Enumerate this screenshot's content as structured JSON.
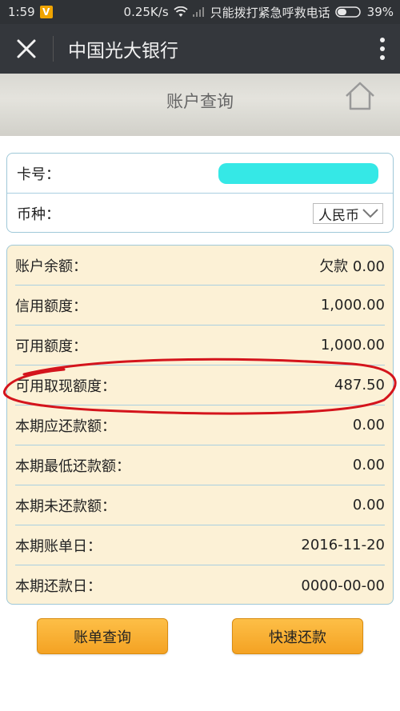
{
  "status_bar": {
    "time": "1:59",
    "app_badge": "V",
    "net_speed": "0.25K/s",
    "carrier": "只能拨打紧急呼救电话",
    "battery": "39%"
  },
  "app_bar": {
    "title": "中国光大银行"
  },
  "page": {
    "title": "账户查询"
  },
  "card": {
    "card_label": "卡号：",
    "currency_label": "币种：",
    "currency_value": "人民币"
  },
  "account": {
    "rows": [
      {
        "label": "账户余额：",
        "value": "欠款 0.00"
      },
      {
        "label": "信用额度：",
        "value": "1,000.00"
      },
      {
        "label": "可用额度：",
        "value": "1,000.00"
      },
      {
        "label": "可用取现额度：",
        "value": "487.50"
      },
      {
        "label": "本期应还款额：",
        "value": "0.00"
      },
      {
        "label": "本期最低还款额：",
        "value": "0.00"
      },
      {
        "label": "本期未还款额：",
        "value": "0.00"
      },
      {
        "label": "本期账单日：",
        "value": "2016-11-20"
      },
      {
        "label": "本期还款日：",
        "value": "0000-00-00"
      }
    ]
  },
  "buttons": {
    "bill_query": "账单查询",
    "quick_repay": "快速还款"
  },
  "colors": {
    "accent_button": "#f4a223",
    "panel_bg": "#fcf1d6",
    "panel_border": "#9fc8d8",
    "annotation": "#d4141c",
    "mask": "#35e8e6"
  }
}
